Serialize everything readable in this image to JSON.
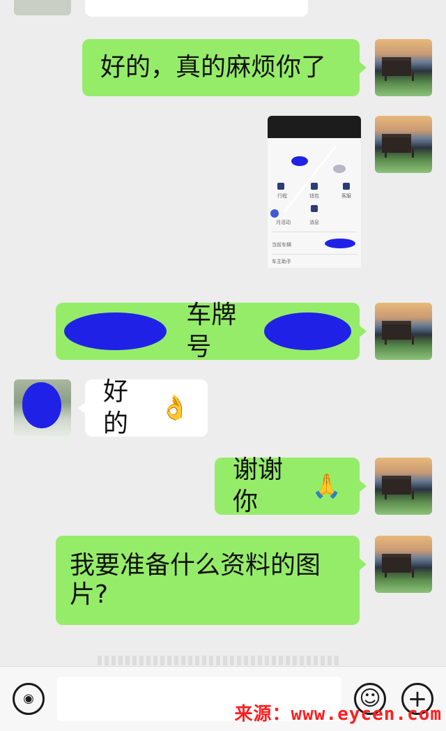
{
  "messages": [
    {
      "side": "me",
      "text": "好的，真的麻烦你了"
    },
    {
      "side": "me",
      "type": "image",
      "screenshot": {
        "labels": [
          "行程",
          "钱包",
          "客服",
          "月活动",
          "消息",
          "当前车辆",
          "车主助手"
        ]
      }
    },
    {
      "side": "me",
      "text": "车牌号"
    },
    {
      "side": "other",
      "text": "好的",
      "emoji": "👌"
    },
    {
      "side": "me",
      "text": "谢谢你",
      "emoji": "🙏"
    },
    {
      "side": "me",
      "text": "我要准备什么资料的图片?"
    }
  ],
  "input_bar": {
    "voice_icon": "voice-icon",
    "emoji_icon": "emoji-icon",
    "plus_icon": "plus-icon",
    "emoji_glyph": "☺",
    "plus_glyph": "+",
    "voice_glyph": "◉"
  },
  "watermark": "来源：www.eycen.com"
}
